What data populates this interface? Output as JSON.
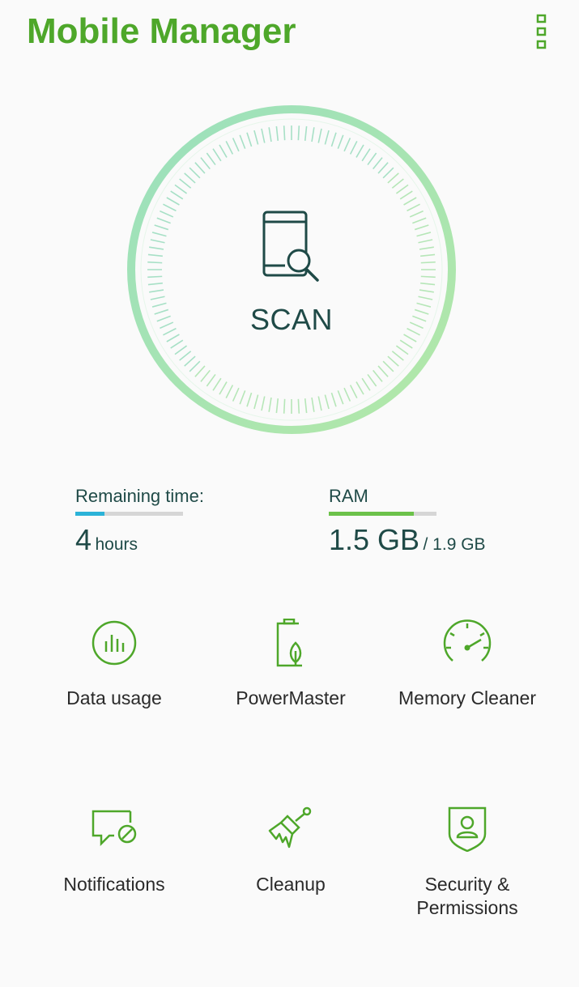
{
  "header": {
    "title": "Mobile Manager",
    "menu_icon": "overflow-menu-icon"
  },
  "scan": {
    "label": "SCAN",
    "icon": "phone-search-icon"
  },
  "stats": {
    "remaining": {
      "label": "Remaining time:",
      "value": "4",
      "unit": "hours",
      "level": 0.27,
      "color": "#2bb3d8"
    },
    "ram": {
      "label": "RAM",
      "used": "1.5 GB",
      "total": "/ 1.9 GB",
      "level": 0.79,
      "color": "#6cc24a"
    }
  },
  "tools": [
    {
      "label": "Data usage",
      "icon": "bar-chart-icon"
    },
    {
      "label": "PowerMaster",
      "icon": "battery-leaf-icon"
    },
    {
      "label": "Memory Cleaner",
      "icon": "speedometer-icon"
    },
    {
      "label": "Notifications",
      "icon": "notification-block-icon"
    },
    {
      "label": "Cleanup",
      "icon": "broom-icon"
    },
    {
      "label": "Security &",
      "label2": "Permissions",
      "icon": "security-shield-icon"
    }
  ],
  "colors": {
    "brand": "#4ea72a",
    "dark_teal": "#1f4a47",
    "dial_green": "#a6e2b7"
  }
}
